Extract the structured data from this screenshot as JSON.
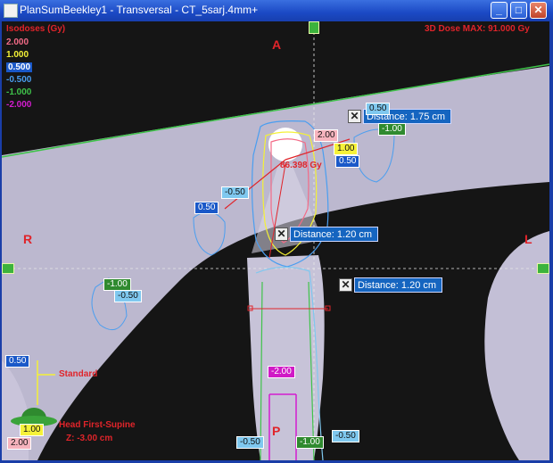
{
  "window": {
    "title": "PlanSumBeekley1 - Transversal - CT_5sarj.4mm+",
    "minimize": "_",
    "maximize": "□",
    "close": "✕"
  },
  "header": {
    "isodoses_title": "Isodoses (Gy)",
    "dose_max": "3D Dose MAX: 91.000 Gy"
  },
  "isodoses": [
    {
      "label": "2.000",
      "color": "#f36b87"
    },
    {
      "label": "1.000",
      "color": "#f4f136"
    },
    {
      "label": "0.500",
      "color": "#ffffff"
    },
    {
      "label": "-0.500",
      "color": "#4a9ef0"
    },
    {
      "label": "-1.000",
      "color": "#3fc34a"
    },
    {
      "label": "-2.000",
      "color": "#d41ccf"
    }
  ],
  "directions": {
    "anterior": "A",
    "posterior": "P",
    "right": "R",
    "left": "L"
  },
  "point_dose": "86.398 Gy",
  "distances": [
    {
      "label": "Distance: 1.75 cm",
      "close": "✕"
    },
    {
      "label": "Distance: 1.20 cm",
      "close": "✕"
    },
    {
      "label": "Distance: 1.20 cm",
      "close": "✕"
    }
  ],
  "tags": {
    "t1": "0.50",
    "t2": "-1.00",
    "t3": "2.00",
    "t4": "1.00",
    "t5": "0.50",
    "t6": "-0.50",
    "t7": "0.50",
    "t8": "-1.00",
    "t9": "-0.50",
    "t10": "-2.00",
    "t11": "0.50",
    "t12": "1.00",
    "t13": "2.00",
    "t14": "-0.50",
    "t15": "-1.00",
    "t16": "-0.50"
  },
  "orientation": {
    "standard": "Standard",
    "patient_position": "Head First-Supine",
    "z_position": "Z: -3.00 cm"
  }
}
